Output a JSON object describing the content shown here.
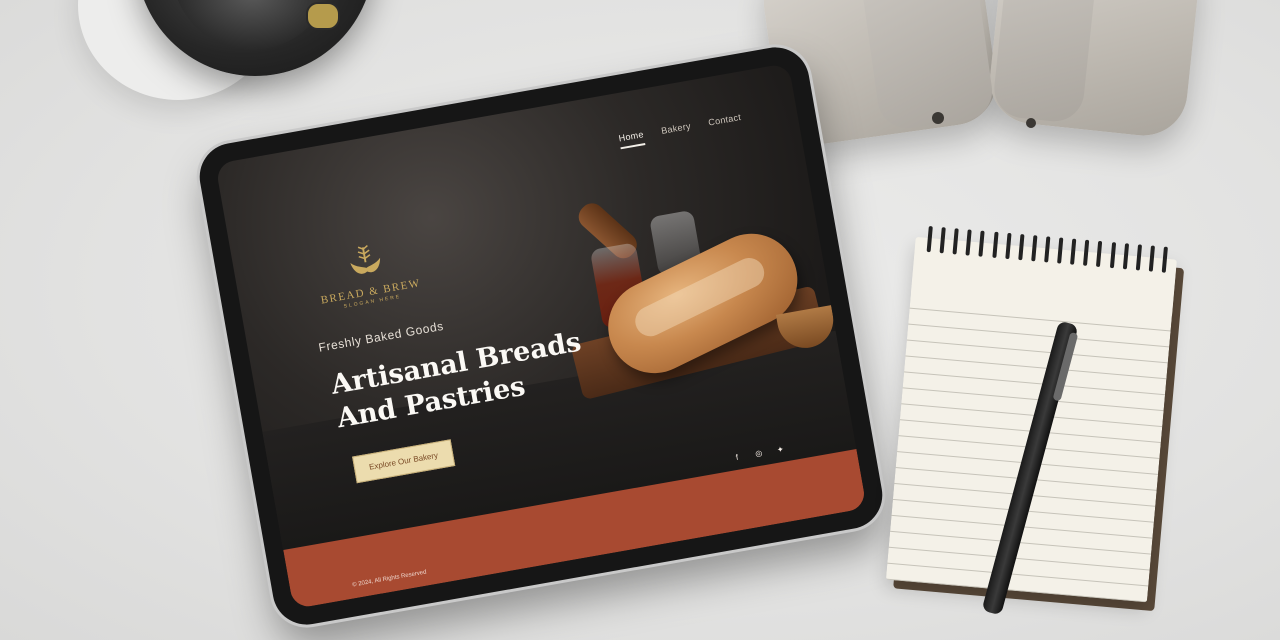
{
  "site": {
    "logo": {
      "name": "BREAD & BREW",
      "slogan": "SLOGAN HERE"
    },
    "nav": {
      "items": [
        "Home",
        "Bakery",
        "Contact"
      ],
      "active": "Home"
    },
    "hero": {
      "tagline": "Freshly Baked Goods",
      "headline_line1": "Artisanal Breads",
      "headline_line2": "And Pastries",
      "cta": "Explore Our Bakery"
    },
    "footer": {
      "copyright": "© 2024, All Rights Reserved",
      "socials": [
        "facebook-icon",
        "instagram-icon",
        "twitter-icon"
      ]
    },
    "colors": {
      "accent": "#a84a31",
      "gold": "#c9a95e",
      "cta_bg": "#ecdcae"
    }
  }
}
